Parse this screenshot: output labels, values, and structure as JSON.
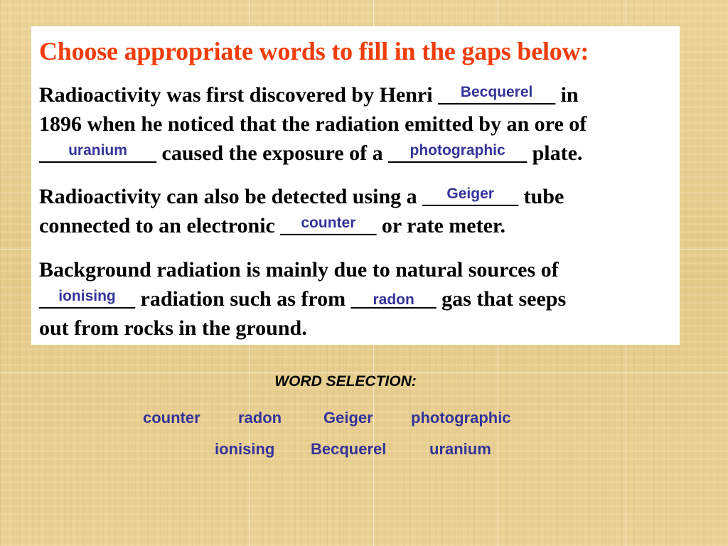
{
  "title": "Choose appropriate words to fill in the gaps below:",
  "paragraphs": [
    {
      "line1_a": "Radioactivity was first discovered by Henri ",
      "blank1": "___________",
      "answer1": "Becquerel",
      "line1_b": " in",
      "line2": "1896 when he noticed that the radiation emitted by an ore of",
      "blank2": "___________",
      "answer2": "uranium",
      "line3_a": " caused the exposure of a ",
      "blank3": "_____________",
      "answer3": "photographic",
      "line3_b": " plate."
    },
    {
      "line1_a": "Radioactivity can also be detected using a ",
      "blank1": "_________",
      "answer1": "Geiger",
      "line1_b": " tube",
      "line2_a": "connected to an electronic ",
      "blank2": "_________",
      "answer2": "counter",
      "line2_b": " or rate meter."
    },
    {
      "line1": "Background radiation is mainly due to natural sources of",
      "blank1": "_________",
      "answer1": "ionising",
      "line2_a": " radiation such as from ",
      "blank2": "________",
      "answer2": "radon",
      "line2_b": " gas that seeps",
      "line3": "out from rocks in the ground."
    }
  ],
  "word_selection": {
    "title": "WORD SELECTION:",
    "row1": [
      "counter",
      "radon",
      "Geiger",
      "photographic"
    ],
    "row2": [
      "ionising",
      "Becquerel",
      "uranium"
    ]
  },
  "colors": {
    "title": "#f03c0a",
    "answers": "#33339a",
    "background": "#e8cf90"
  }
}
